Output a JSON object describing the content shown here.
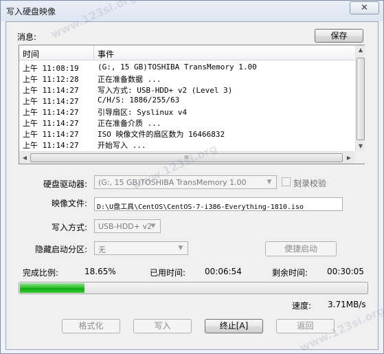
{
  "window": {
    "title": "写入硬盘映像",
    "close_glyph": "✕"
  },
  "message": {
    "label": "消息:",
    "save_label": "保存"
  },
  "log": {
    "columns": [
      "时间",
      "事件"
    ],
    "rows": [
      {
        "time": "上午 11:08:19",
        "event": "(G:, 15 GB)TOSHIBA TransMemory     1.00"
      },
      {
        "time": "上午 11:12:28",
        "event": "正在准备数据 ..."
      },
      {
        "time": "上午 11:14:27",
        "event": "写入方式: USB-HDD+ v2 (Level 3)"
      },
      {
        "time": "上午 11:14:27",
        "event": "C/H/S: 1886/255/63"
      },
      {
        "time": "上午 11:14:27",
        "event": "引导扇区: Syslinux v4"
      },
      {
        "time": "上午 11:14:27",
        "event": "正在准备介质 ..."
      },
      {
        "time": "上午 11:14:27",
        "event": "ISO 映像文件的扇区数为 16466832"
      },
      {
        "time": "上午 11:14:27",
        "event": "开始写入 ..."
      }
    ],
    "hscroll_grip": "III"
  },
  "form": {
    "drive_label": "硬盘驱动器:",
    "drive_value": "(G:, 15 GB)TOSHIBA TransMemory     1.00",
    "verify_label": "刻录校验",
    "image_label": "映像文件:",
    "image_value": "D:\\U盘工具\\CentOS\\CentOS-7-i386-Everything-1810.iso",
    "write_mode_label": "写入方式:",
    "write_mode_value": "USB-HDD+ v2",
    "hidden_boot_label": "隐藏启动分区:",
    "hidden_boot_value": "无",
    "quick_boot_label": "便捷启动"
  },
  "status": {
    "complete_label": "完成比例:",
    "complete_value": "18.65%",
    "progress": 0.1865,
    "elapsed_label": "已用时间:",
    "elapsed_value": "00:06:54",
    "remaining_label": "剩余时间:",
    "remaining_value": "00:30:05",
    "speed_label": "速度:",
    "speed_value": "3.71MB/s"
  },
  "buttons": {
    "format": "格式化",
    "write": "写入",
    "stop": "终止[A]",
    "back": "返回"
  },
  "watermark": "www.123si.org"
}
